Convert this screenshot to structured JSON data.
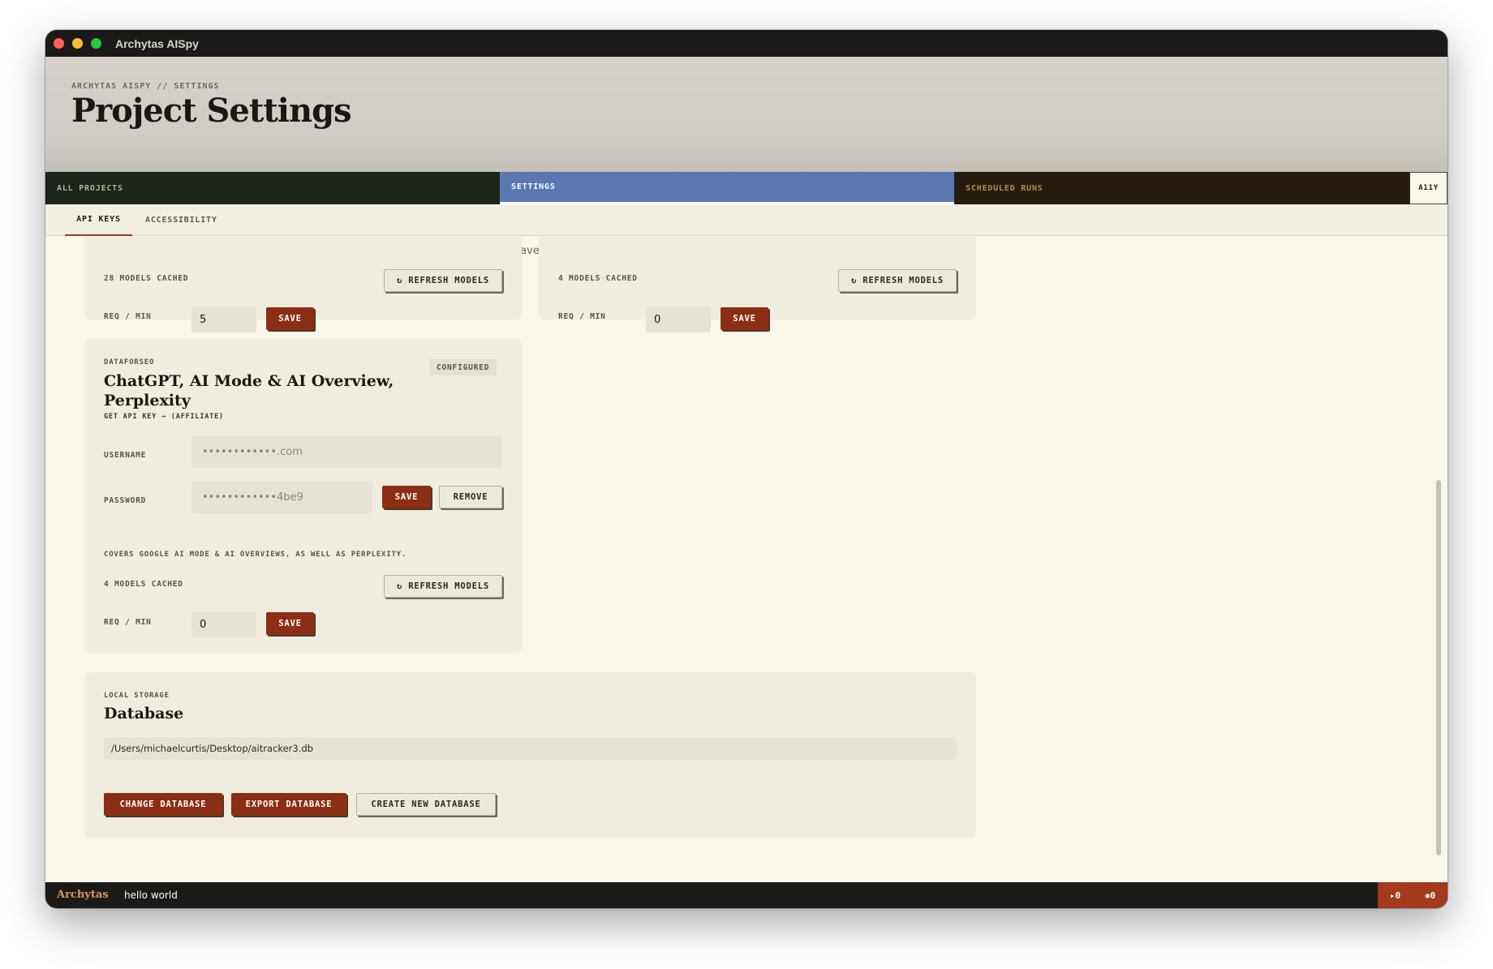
{
  "window": {
    "title": "Archytas AISpy"
  },
  "header": {
    "breadcrumb": "ARCHYTAS AISPY // SETTINGS",
    "title": "Project Settings"
  },
  "nav": {
    "all_projects": "ALL PROJECTS",
    "settings": "SETTINGS",
    "scheduled_runs": "SCHEDULED RUNS",
    "a11y": "A11Y"
  },
  "subtabs": {
    "api_keys": "API KEYS",
    "accessibility": "ACCESSIBILITY"
  },
  "note": "API keys are encrypted using your operating system's secure storage and never leave this machine.",
  "cards": {
    "top_left": {
      "models_cached": "28 MODELS CACHED",
      "refresh_label": "↻ REFRESH MODELS",
      "req_label": "REQ / MIN",
      "req_value": "5",
      "save_label": "SAVE"
    },
    "top_right": {
      "models_cached": "4 MODELS CACHED",
      "refresh_label": "↻ REFRESH MODELS",
      "req_label": "REQ / MIN",
      "req_value": "0",
      "save_label": "SAVE"
    },
    "dataforseo": {
      "provider": "DATAFORSEO",
      "title_line1": "ChatGPT, AI Mode & AI Overview,",
      "title_line2": "Perplexity",
      "api_link": "GET API KEY → (AFFILIATE)",
      "badge": "CONFIGURED",
      "username_label": "USERNAME",
      "username_value": "••••••••••••.com",
      "password_label": "PASSWORD",
      "password_value": "••••••••••••4be9",
      "save_label": "SAVE",
      "remove_label": "REMOVE",
      "coverage": "COVERS GOOGLE AI MODE & AI OVERVIEWS, AS WELL AS PERPLEXITY.",
      "models_cached": "4 MODELS CACHED",
      "refresh_label": "↻ REFRESH MODELS",
      "req_label": "REQ / MIN",
      "req_value": "0",
      "req_save_label": "SAVE"
    },
    "database": {
      "kicker": "LOCAL STORAGE",
      "title": "Database",
      "path": "/Users/michaelcurtis/Desktop/aitracker3.db",
      "change_label": "CHANGE DATABASE",
      "export_label": "EXPORT DATABASE",
      "create_label": "CREATE NEW DATABASE"
    }
  },
  "statusbar": {
    "brand": "Archytas",
    "message": "hello world",
    "runs_count": "▸0",
    "errors_count": "✺0"
  },
  "colors": {
    "accent_red": "#8c2e14",
    "settings_blue": "#5a77b2",
    "background": "#f9f6ea"
  }
}
